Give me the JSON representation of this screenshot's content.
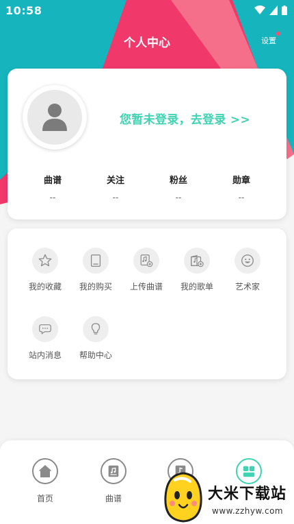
{
  "status_bar": {
    "time": "10:58"
  },
  "header": {
    "title": "个人中心",
    "settings_label": "设置"
  },
  "profile": {
    "login_prompt": "您暂未登录，去登录 >>",
    "stats": [
      {
        "label": "曲谱",
        "value": "--"
      },
      {
        "label": "关注",
        "value": "--"
      },
      {
        "label": "粉丝",
        "value": "--"
      },
      {
        "label": "勋章",
        "value": "--"
      }
    ]
  },
  "menu": {
    "items": [
      {
        "label": "我的收藏",
        "icon": "star-icon"
      },
      {
        "label": "我的购买",
        "icon": "book-icon"
      },
      {
        "label": "上传曲谱",
        "icon": "upload-score-icon"
      },
      {
        "label": "我的歌单",
        "icon": "playlist-icon"
      },
      {
        "label": "艺术家",
        "icon": "smiley-icon"
      },
      {
        "label": "站内消息",
        "icon": "chat-bubble-icon"
      },
      {
        "label": "帮助中心",
        "icon": "lightbulb-icon"
      }
    ]
  },
  "bottom_nav": {
    "items": [
      {
        "label": "首页",
        "icon": "home-icon"
      },
      {
        "label": "曲谱",
        "icon": "score-icon"
      },
      {
        "label": "",
        "icon": "music-icon"
      },
      {
        "label": "",
        "icon": "profile-icon",
        "active": true
      }
    ]
  },
  "watermark": {
    "text": "大米下载站",
    "url": "www.zzhyw.com"
  },
  "colors": {
    "accent": "#3fd3b1",
    "teal": "#16b5be",
    "pink": "#f0386b"
  }
}
